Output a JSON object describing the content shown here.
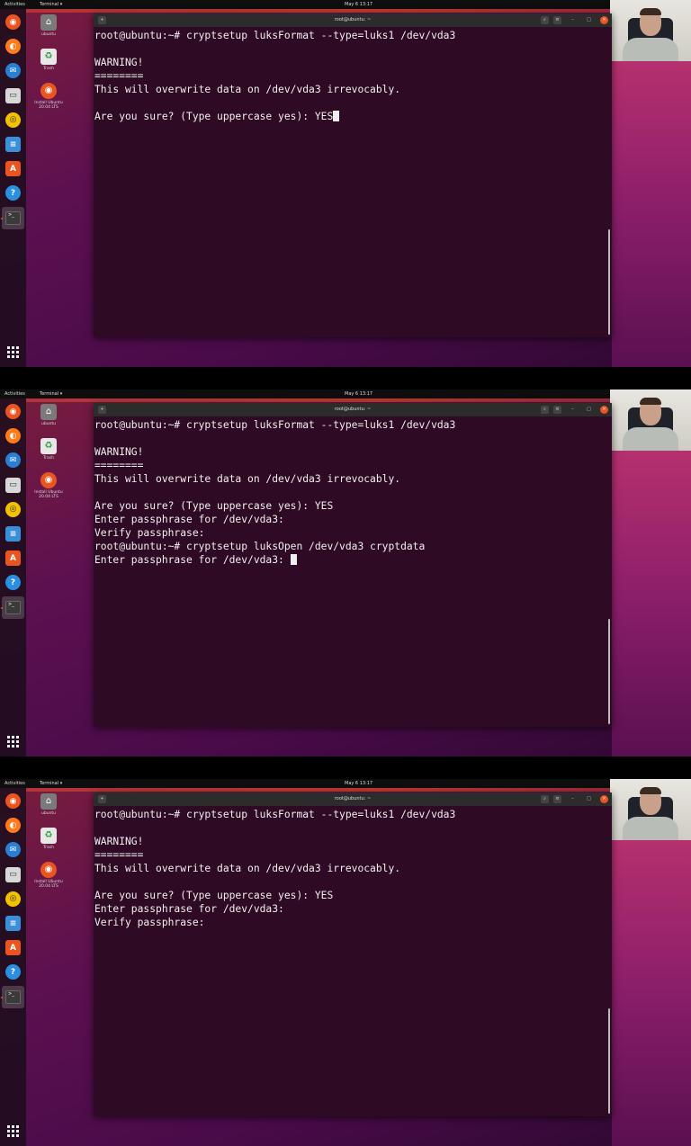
{
  "topbar": {
    "activities": "Activities",
    "app_menu": "Terminal ▾",
    "clock": "May 6  13:17"
  },
  "dock": {
    "icons": [
      "ubuntu-software-icon",
      "firefox-icon",
      "thunderbird-icon",
      "files-icon",
      "rhythmbox-icon",
      "libreoffice-writer-icon",
      "app-center-icon",
      "help-icon",
      "terminal-icon"
    ],
    "show_apps": "show-applications-icon"
  },
  "desktop": {
    "icons": [
      {
        "label": "ubuntu",
        "icon": "home-folder-icon"
      },
      {
        "label": "Trash",
        "icon": "trash-icon"
      },
      {
        "label": "Install Ubuntu 20.04 LTS",
        "icon": "install-ubuntu-icon"
      }
    ]
  },
  "terminal": {
    "title": "root@ubuntu: ~"
  },
  "frames": [
    {
      "lines": [
        "root@ubuntu:~# cryptsetup luksFormat --type=luks1 /dev/vda3",
        "",
        "WARNING!",
        "========",
        "This will overwrite data on /dev/vda3 irrevocably.",
        "",
        "Are you sure? (Type uppercase yes): YES"
      ],
      "cursor_after_last": true
    },
    {
      "lines": [
        "root@ubuntu:~# cryptsetup luksFormat --type=luks1 /dev/vda3",
        "",
        "WARNING!",
        "========",
        "This will overwrite data on /dev/vda3 irrevocably.",
        "",
        "Are you sure? (Type uppercase yes): YES",
        "Enter passphrase for /dev/vda3:",
        "Verify passphrase:",
        "root@ubuntu:~# cryptsetup luksOpen /dev/vda3 cryptdata",
        "Enter passphrase for /dev/vda3: "
      ],
      "cursor_after_last": true
    },
    {
      "lines": [
        "root@ubuntu:~# cryptsetup luksFormat --type=luks1 /dev/vda3",
        "",
        "WARNING!",
        "========",
        "This will overwrite data on /dev/vda3 irrevocably.",
        "",
        "Are you sure? (Type uppercase yes): YES",
        "Enter passphrase for /dev/vda3:",
        "Verify passphrase:"
      ],
      "cursor_after_last": false
    }
  ]
}
